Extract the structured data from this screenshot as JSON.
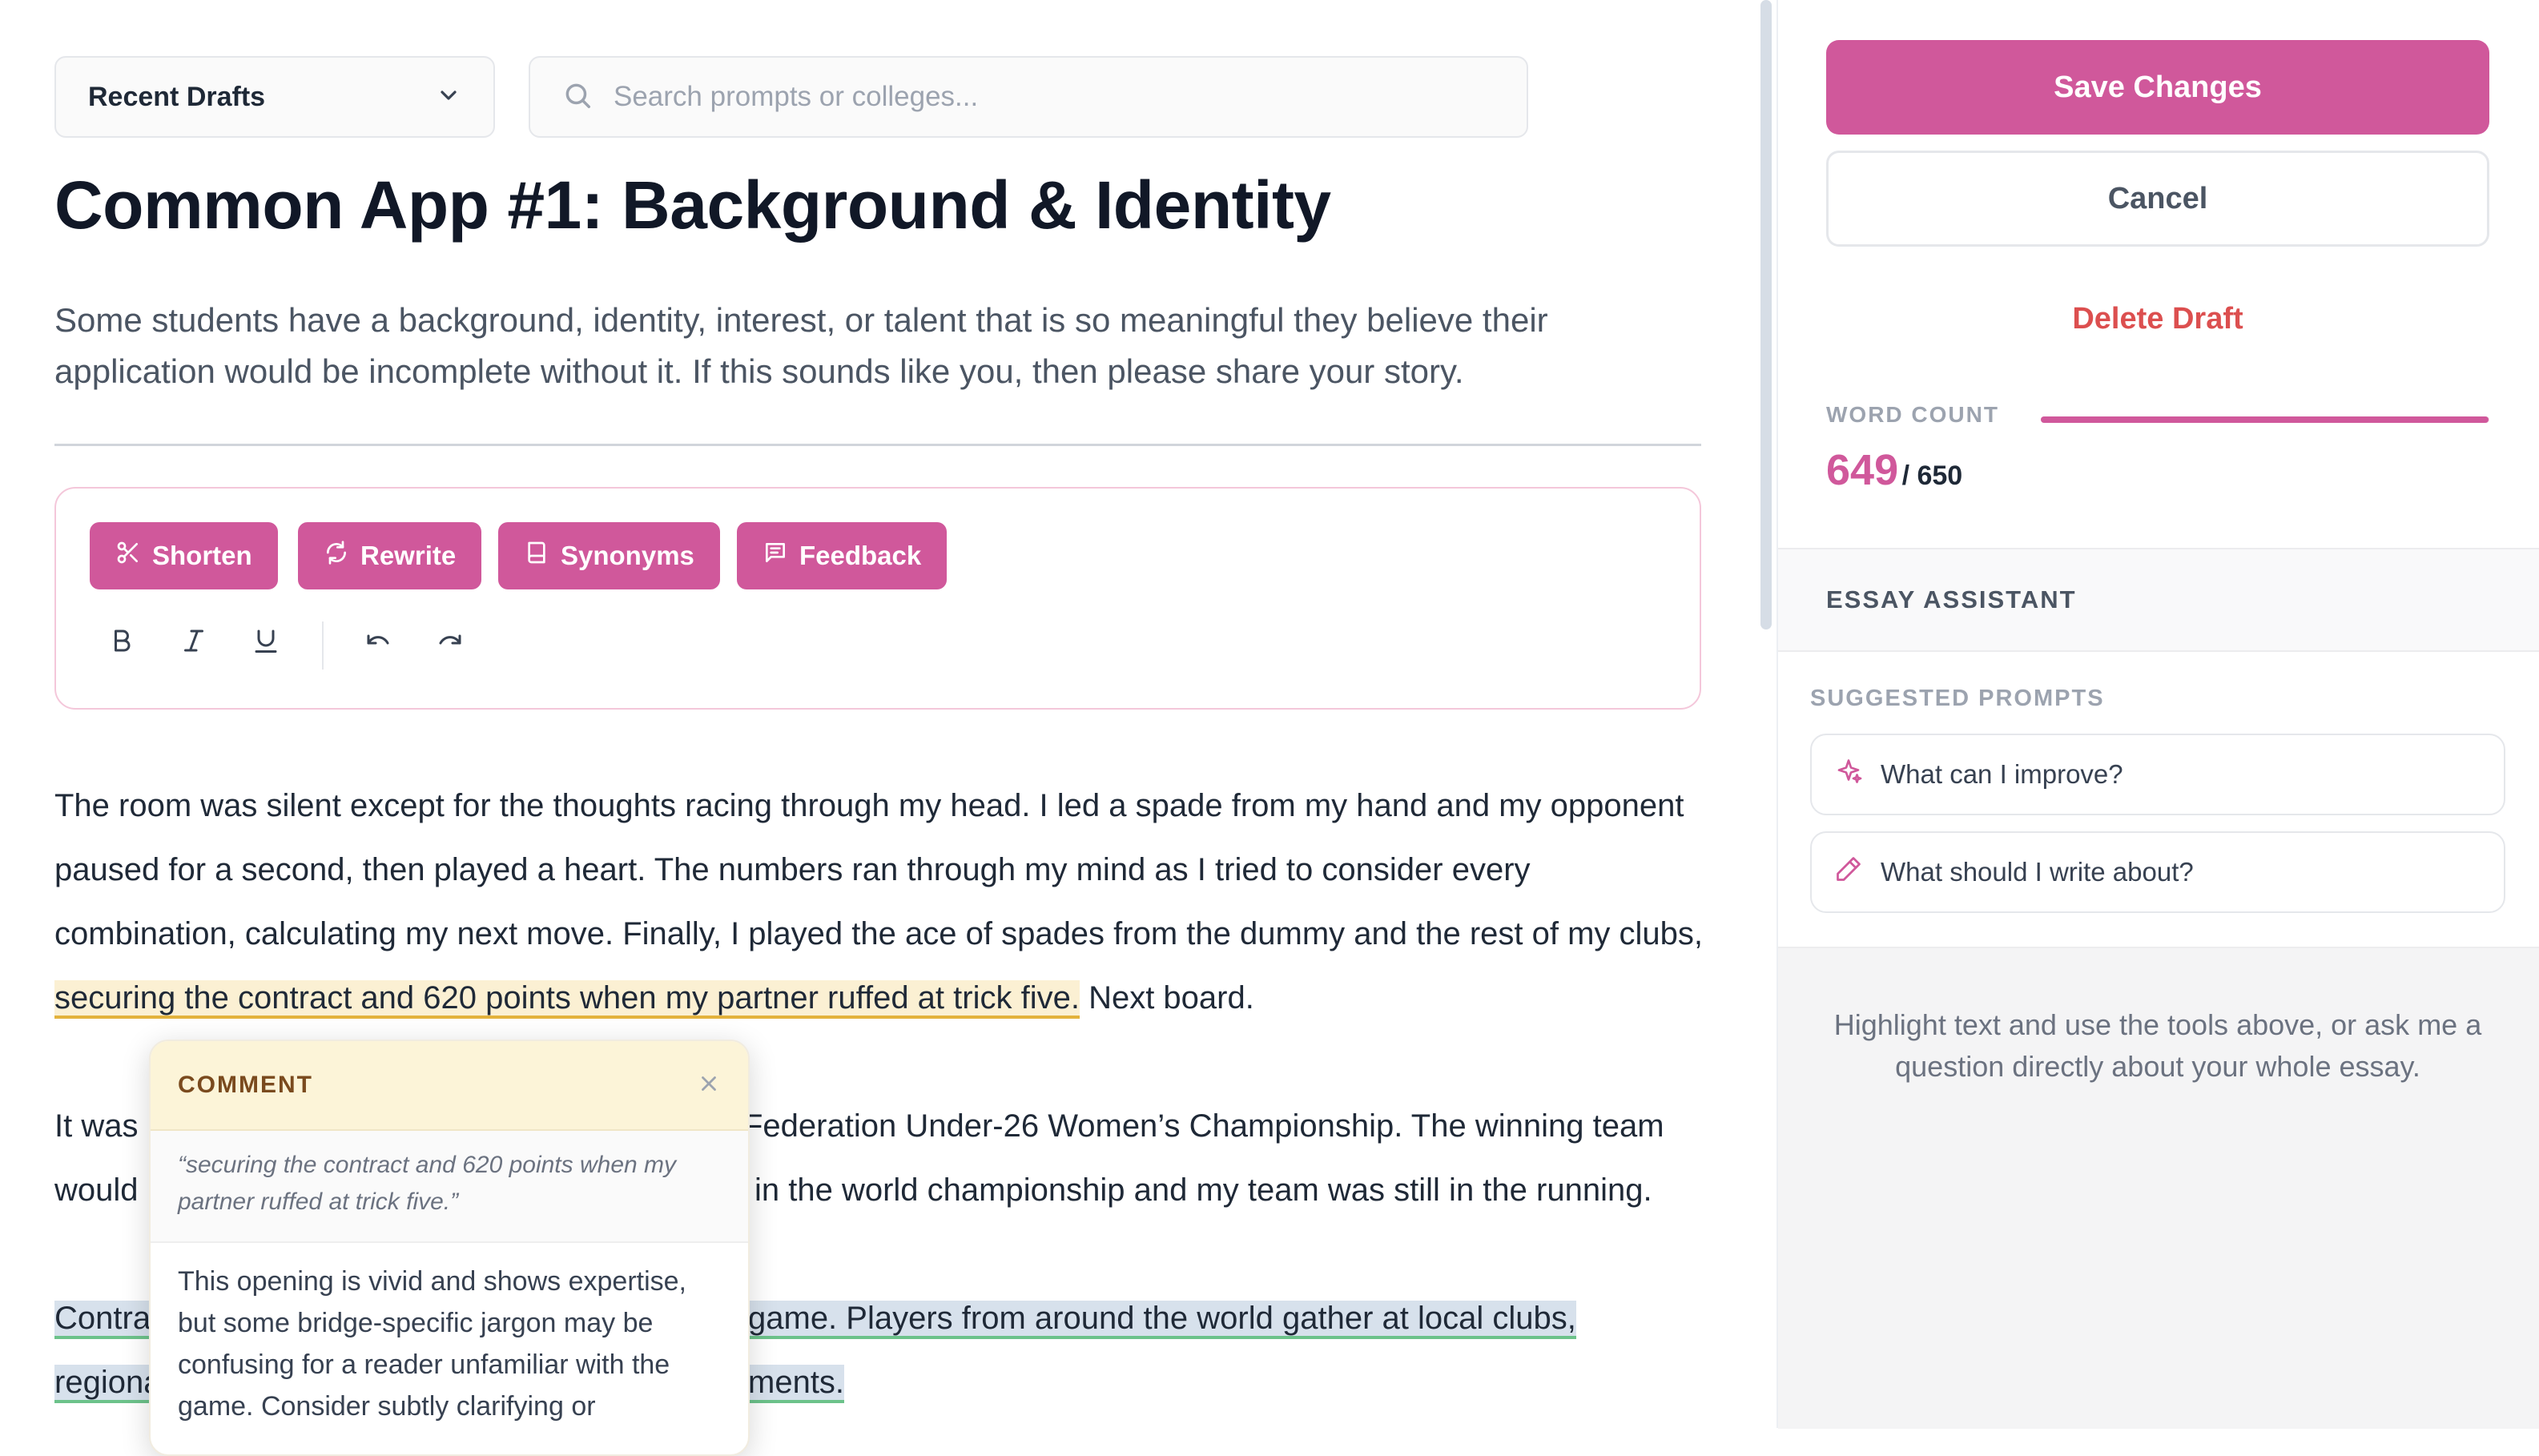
{
  "toolbar": {
    "drafts_dropdown": "Recent Drafts",
    "search_placeholder": "Search prompts or colleges..."
  },
  "prompt": {
    "title": "Common App #1: Background & Identity",
    "description": "Some students have a background, identity, interest, or talent that is so meaningful they believe their application would be incomplete without it. If this sounds like you, then please share your story."
  },
  "editor": {
    "ai_buttons": {
      "shorten": "Shorten",
      "rewrite": "Rewrite",
      "synonyms": "Synonyms",
      "feedback": "Feedback"
    },
    "format_icons": [
      "bold-icon",
      "italic-icon",
      "underline-icon",
      "undo-icon",
      "redo-icon"
    ]
  },
  "essay": {
    "p1_before": "The room was silent except for the thoughts racing through my head. I led a spade from my hand and my opponent paused for a second, then played a heart. The numbers ran through my mind as I tried to consider every combination, calculating my next move. Finally, I played the ace of spades from the dummy and the rest of my clubs, ",
    "p1_highlight": "securing the contract and 620 points when my partner ruffed at trick five.",
    "p1_after": " Next board.",
    "p2_line1_left": "It was",
    "p2_line1_right": "Federation Under-26 Women’s Championship. The winning team",
    "p2_line2_left": "would",
    "p2_line2_right": "in the world championship and my team was still in the running.",
    "p3_line1_left": "Contra",
    "p3_line1_right": "game. Players from around the world gather at local clubs,",
    "p3_line2_left": "regiona",
    "p3_line2_right": "ments."
  },
  "comment": {
    "label": "COMMENT",
    "quote": "“securing the contract and 620 points when my partner ruffed at trick five.”",
    "body": "This opening is vivid and shows expertise, but some bridge-specific jargon may be confusing for a reader unfamiliar with the game. Consider subtly clarifying or"
  },
  "sidebar": {
    "save_label": "Save Changes",
    "cancel_label": "Cancel",
    "delete_label": "Delete Draft",
    "word_count_label": "WORD COUNT",
    "word_count": "649",
    "word_limit": "/ 650",
    "word_count_fraction": 0.9985,
    "assistant_title": "ESSAY ASSISTANT",
    "suggested_label": "SUGGESTED PROMPTS",
    "suggestions": [
      "What can I improve?",
      "What should I write about?"
    ],
    "hint": "Highlight text and use the tools above, or ask me a question directly about your whole essay."
  },
  "colors": {
    "accent": "#d0589b",
    "danger": "#dc4f4f",
    "highlight_yellow": "#fbf0d3",
    "highlight_blue": "#d7e1ec"
  }
}
